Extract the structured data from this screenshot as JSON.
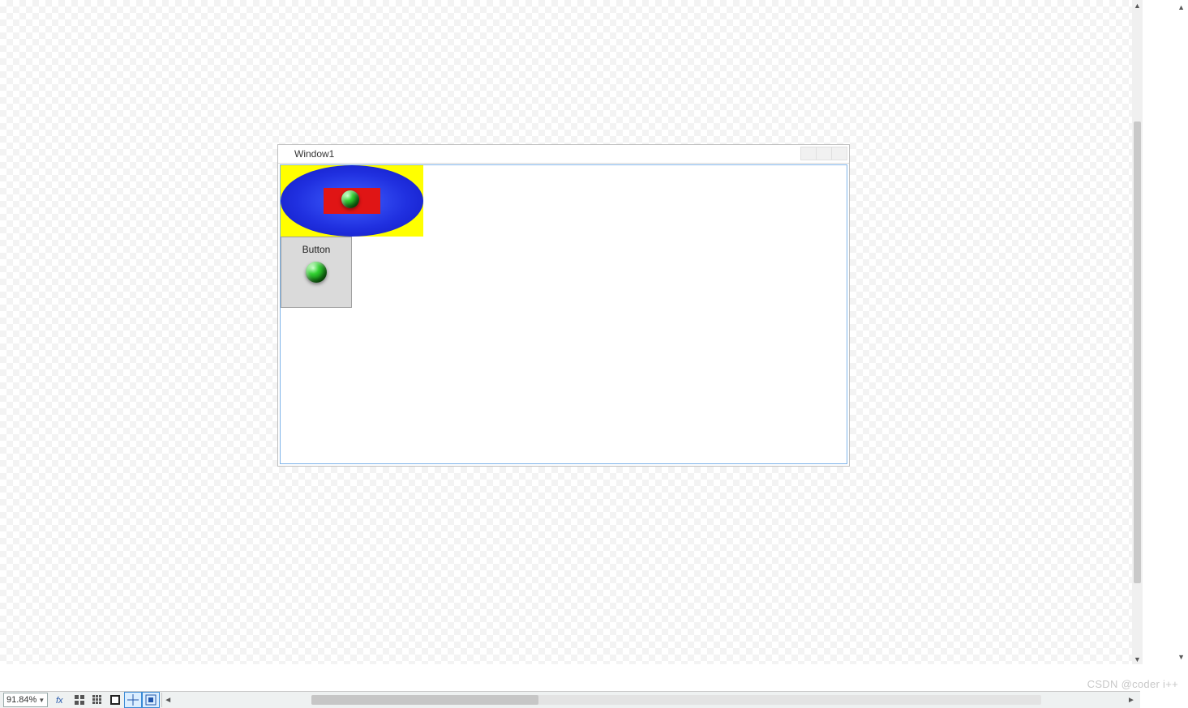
{
  "window": {
    "title": "Window1",
    "button_label": "Button"
  },
  "statusbar": {
    "zoom": "91.84%"
  },
  "watermark": "CSDN @coder i++",
  "icons": {
    "fx": "fx",
    "grid_large": "grid-large",
    "grid_small": "grid-small",
    "invert": "invert",
    "crosshair": "crosshair",
    "fit": "fit-to-screen"
  }
}
